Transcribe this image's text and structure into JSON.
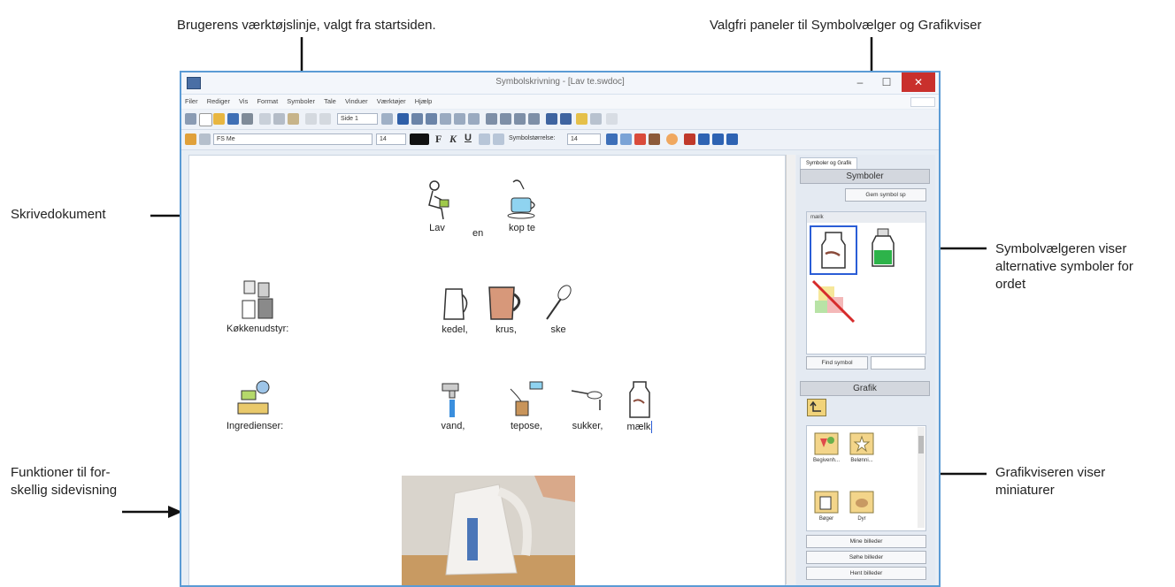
{
  "callouts": {
    "toolbar": "Brugerens værktøjslinje, valgt fra startsiden.",
    "panels": "Valgfri paneler til Symbolvælger og Grafikviser",
    "document": "Skrivedokument",
    "symbolchooser_line1": "Symbolvælgeren viser",
    "symbolchooser_line2": "alternative symboler for",
    "symbolchooser_line3": "ordet",
    "pageview_line1": "Funktioner til for-",
    "pageview_line2": "skellig sidevisning",
    "graphics_line1": "Grafikviseren viser",
    "graphics_line2": "miniaturer"
  },
  "window": {
    "title": "Symbolskrivning - [Lav te.swdoc]",
    "min": "–",
    "max": "☐",
    "close": "✕"
  },
  "menu": [
    "Filer",
    "Rediger",
    "Vis",
    "Format",
    "Symboler",
    "Tale",
    "Vinduer",
    "Værktøjer",
    "Hjælp"
  ],
  "toolbar": {
    "page_select": "Side 1",
    "font_name": "FS Me",
    "font_size": "14",
    "bold": "F",
    "italic": "K",
    "underline": "U",
    "symbol_size_label": "Symbolstørrelse:",
    "symbol_size": "14"
  },
  "document": {
    "line1": [
      "Lav",
      "en",
      "kop te"
    ],
    "kitchen_label": "Køkkenudstyr:",
    "kitchen_items": [
      "kedel,",
      "krus,",
      "ske"
    ],
    "ingredients_label": "Ingredienser:",
    "ingredient_items": [
      "vand,",
      "tepose,",
      "sukker,",
      "mælk"
    ]
  },
  "panel": {
    "tab": "Symboler og Grafik",
    "symbols_header": "Symboler",
    "save_symbol": "Gem symbol sp",
    "symbol_word": "mælk",
    "find_symbol": "Find symbol",
    "graphics_header": "Grafik",
    "thumbs": [
      "Begivenh...",
      "Belønni...",
      "Bøger",
      "Dyr"
    ],
    "btn1": "Mine billeder",
    "btn2": "Søhe billeder",
    "btn3": "Hent billeder"
  },
  "colors": {
    "window_border": "#5b9bd5",
    "close_button": "#c9302c",
    "selection": "#2a5dd6"
  }
}
